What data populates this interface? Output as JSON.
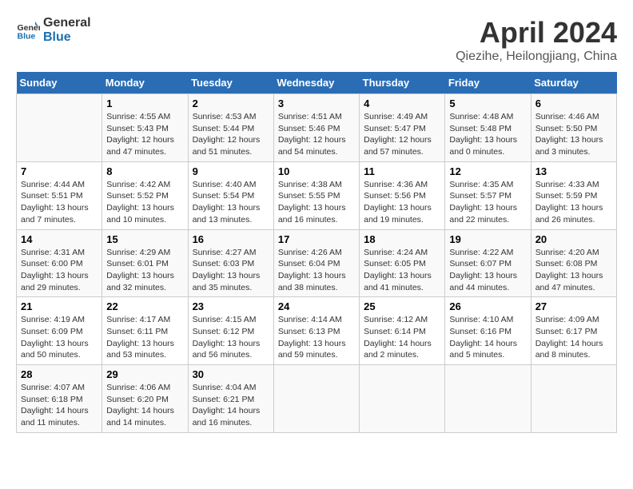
{
  "header": {
    "logo_line1": "General",
    "logo_line2": "Blue",
    "month_title": "April 2024",
    "subtitle": "Qiezihe, Heilongjiang, China"
  },
  "days_of_week": [
    "Sunday",
    "Monday",
    "Tuesday",
    "Wednesday",
    "Thursday",
    "Friday",
    "Saturday"
  ],
  "weeks": [
    [
      {
        "day": "",
        "info": ""
      },
      {
        "day": "1",
        "info": "Sunrise: 4:55 AM\nSunset: 5:43 PM\nDaylight: 12 hours\nand 47 minutes."
      },
      {
        "day": "2",
        "info": "Sunrise: 4:53 AM\nSunset: 5:44 PM\nDaylight: 12 hours\nand 51 minutes."
      },
      {
        "day": "3",
        "info": "Sunrise: 4:51 AM\nSunset: 5:46 PM\nDaylight: 12 hours\nand 54 minutes."
      },
      {
        "day": "4",
        "info": "Sunrise: 4:49 AM\nSunset: 5:47 PM\nDaylight: 12 hours\nand 57 minutes."
      },
      {
        "day": "5",
        "info": "Sunrise: 4:48 AM\nSunset: 5:48 PM\nDaylight: 13 hours\nand 0 minutes."
      },
      {
        "day": "6",
        "info": "Sunrise: 4:46 AM\nSunset: 5:50 PM\nDaylight: 13 hours\nand 3 minutes."
      }
    ],
    [
      {
        "day": "7",
        "info": "Sunrise: 4:44 AM\nSunset: 5:51 PM\nDaylight: 13 hours\nand 7 minutes."
      },
      {
        "day": "8",
        "info": "Sunrise: 4:42 AM\nSunset: 5:52 PM\nDaylight: 13 hours\nand 10 minutes."
      },
      {
        "day": "9",
        "info": "Sunrise: 4:40 AM\nSunset: 5:54 PM\nDaylight: 13 hours\nand 13 minutes."
      },
      {
        "day": "10",
        "info": "Sunrise: 4:38 AM\nSunset: 5:55 PM\nDaylight: 13 hours\nand 16 minutes."
      },
      {
        "day": "11",
        "info": "Sunrise: 4:36 AM\nSunset: 5:56 PM\nDaylight: 13 hours\nand 19 minutes."
      },
      {
        "day": "12",
        "info": "Sunrise: 4:35 AM\nSunset: 5:57 PM\nDaylight: 13 hours\nand 22 minutes."
      },
      {
        "day": "13",
        "info": "Sunrise: 4:33 AM\nSunset: 5:59 PM\nDaylight: 13 hours\nand 26 minutes."
      }
    ],
    [
      {
        "day": "14",
        "info": "Sunrise: 4:31 AM\nSunset: 6:00 PM\nDaylight: 13 hours\nand 29 minutes."
      },
      {
        "day": "15",
        "info": "Sunrise: 4:29 AM\nSunset: 6:01 PM\nDaylight: 13 hours\nand 32 minutes."
      },
      {
        "day": "16",
        "info": "Sunrise: 4:27 AM\nSunset: 6:03 PM\nDaylight: 13 hours\nand 35 minutes."
      },
      {
        "day": "17",
        "info": "Sunrise: 4:26 AM\nSunset: 6:04 PM\nDaylight: 13 hours\nand 38 minutes."
      },
      {
        "day": "18",
        "info": "Sunrise: 4:24 AM\nSunset: 6:05 PM\nDaylight: 13 hours\nand 41 minutes."
      },
      {
        "day": "19",
        "info": "Sunrise: 4:22 AM\nSunset: 6:07 PM\nDaylight: 13 hours\nand 44 minutes."
      },
      {
        "day": "20",
        "info": "Sunrise: 4:20 AM\nSunset: 6:08 PM\nDaylight: 13 hours\nand 47 minutes."
      }
    ],
    [
      {
        "day": "21",
        "info": "Sunrise: 4:19 AM\nSunset: 6:09 PM\nDaylight: 13 hours\nand 50 minutes."
      },
      {
        "day": "22",
        "info": "Sunrise: 4:17 AM\nSunset: 6:11 PM\nDaylight: 13 hours\nand 53 minutes."
      },
      {
        "day": "23",
        "info": "Sunrise: 4:15 AM\nSunset: 6:12 PM\nDaylight: 13 hours\nand 56 minutes."
      },
      {
        "day": "24",
        "info": "Sunrise: 4:14 AM\nSunset: 6:13 PM\nDaylight: 13 hours\nand 59 minutes."
      },
      {
        "day": "25",
        "info": "Sunrise: 4:12 AM\nSunset: 6:14 PM\nDaylight: 14 hours\nand 2 minutes."
      },
      {
        "day": "26",
        "info": "Sunrise: 4:10 AM\nSunset: 6:16 PM\nDaylight: 14 hours\nand 5 minutes."
      },
      {
        "day": "27",
        "info": "Sunrise: 4:09 AM\nSunset: 6:17 PM\nDaylight: 14 hours\nand 8 minutes."
      }
    ],
    [
      {
        "day": "28",
        "info": "Sunrise: 4:07 AM\nSunset: 6:18 PM\nDaylight: 14 hours\nand 11 minutes."
      },
      {
        "day": "29",
        "info": "Sunrise: 4:06 AM\nSunset: 6:20 PM\nDaylight: 14 hours\nand 14 minutes."
      },
      {
        "day": "30",
        "info": "Sunrise: 4:04 AM\nSunset: 6:21 PM\nDaylight: 14 hours\nand 16 minutes."
      },
      {
        "day": "",
        "info": ""
      },
      {
        "day": "",
        "info": ""
      },
      {
        "day": "",
        "info": ""
      },
      {
        "day": "",
        "info": ""
      }
    ]
  ]
}
